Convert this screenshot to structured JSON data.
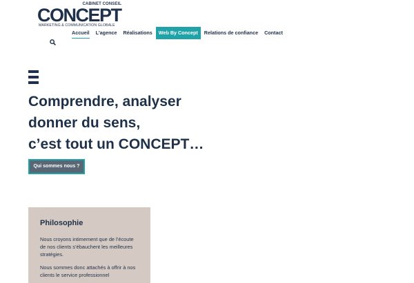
{
  "logo": {
    "top_text": "CABINET CONSEIL",
    "word": "CONCEPT",
    "tagline": "MARKETING & COMMUNICATION GLOBALE"
  },
  "nav": {
    "items": [
      {
        "label": "Accueil"
      },
      {
        "label": "L'agence"
      },
      {
        "label": "Réalisations"
      },
      {
        "label": "Web By Concept"
      },
      {
        "label": "Relations de confiance"
      },
      {
        "label": "Contact"
      }
    ]
  },
  "hero": {
    "line1": "Comprendre, analyser",
    "line2": "donner du sens,",
    "line3": "c’est tout un CONCEPT…",
    "cta_label": "Qui sommes nous ?"
  },
  "card": {
    "title": "Philosophie",
    "p1": "Nous croyons intimement que de l’écoute de nos clients s’ébauchent les meilleures stratégies.",
    "p2": "Nous sommes donc attachés à offrir à nos clients le service professionnel"
  },
  "colors": {
    "accent": "#1fa3a8",
    "navy": "#1f3149",
    "card_bg": "#d5cac3",
    "cta_bg": "#596673"
  }
}
